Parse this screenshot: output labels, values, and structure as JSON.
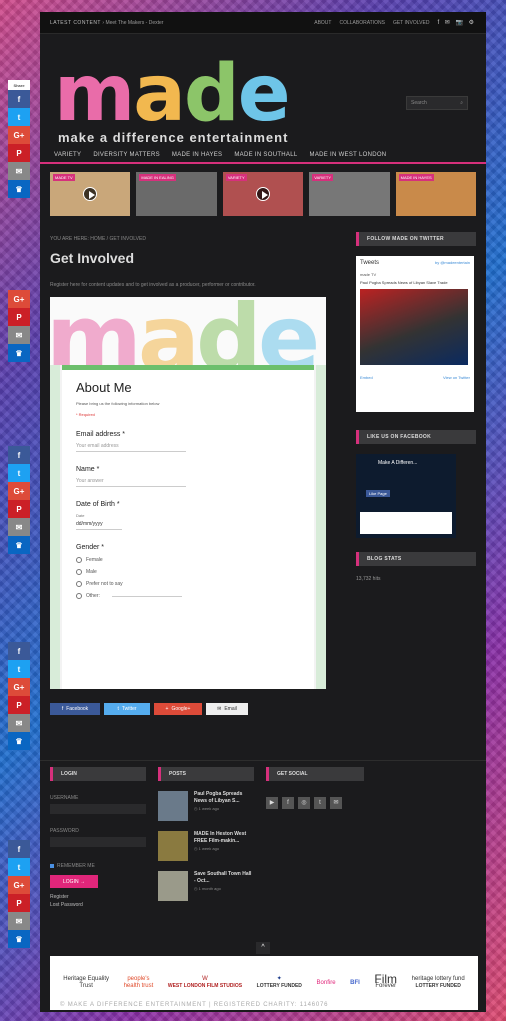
{
  "topbar": {
    "latest_label": "LATEST CONTENT",
    "latest_text": "Meet The Makers - Dexter",
    "links": [
      "ABOUT",
      "COLLABORATIONS",
      "GET INVOLVED"
    ],
    "social": "f ✉ 📷 ⚙"
  },
  "logo": {
    "letters": [
      "m",
      "a",
      "d",
      "e"
    ],
    "tagline": "make a difference entertainment"
  },
  "search": {
    "placeholder": "Search"
  },
  "nav": {
    "items": [
      "VARIETY",
      "DIVERSITY MATTERS",
      "MADE IN HAYES",
      "MADE IN SOUTHALL",
      "MADE IN WEST LONDON"
    ]
  },
  "thumbs": [
    {
      "tag": "MADE TV",
      "play": true,
      "color": "#c9a77a"
    },
    {
      "tag": "MADE IN EALING",
      "play": false,
      "color": "#6a6a6a"
    },
    {
      "tag": "VARIETY",
      "play": true,
      "color": "#b05050"
    },
    {
      "tag": "VARIETY",
      "play": false,
      "color": "#777"
    },
    {
      "tag": "MADE IN HAYES",
      "play": false,
      "color": "#c98a4a"
    }
  ],
  "main": {
    "breadcrumb": "YOU ARE HERE: HOME / GET INVOLVED",
    "title": "Get Involved",
    "intro": "Register here for content updates and to get involved as a producer, performer or contributor.",
    "form": {
      "title": "About Me",
      "desc": "Please bring us the following information below",
      "required": "* Required",
      "email_label": "Email address *",
      "email_placeholder": "Your email address",
      "name_label": "Name *",
      "name_placeholder": "Your answer",
      "dob_label": "Date of Birth *",
      "dob_small": "Date",
      "dob_value": "dd/mm/yyyy",
      "gender_label": "Gender *",
      "gender_options": [
        "Female",
        "Male",
        "Prefer not to say",
        "Other:"
      ]
    },
    "share": [
      {
        "label": "Facebook",
        "icon": "f",
        "color": "#3b5998"
      },
      {
        "label": "Twitter",
        "icon": "t",
        "color": "#55acee"
      },
      {
        "label": "Google+",
        "icon": "+",
        "color": "#dd4b39"
      },
      {
        "label": "Email",
        "icon": "✉",
        "color": "#eeeeee"
      }
    ]
  },
  "sidebar": {
    "twitter_title": "FOLLOW MADE ON TWITTER",
    "tweets_head": "Tweets",
    "tweets_by": "by @madeentertain",
    "tweet_user": "made TV",
    "tweet_text": "Paul Pogba Spreads News of Libyan Slave Trade",
    "tw_embed": "Embed",
    "tw_view": "View on Twitter",
    "facebook_title": "LIKE US ON FACEBOOK",
    "fb_page": "Make A Differen...",
    "fb_like": "Like Page",
    "stats_title": "BLOG STATS",
    "stats_value": "13,732 hits"
  },
  "footer": {
    "login_title": "LOGIN",
    "username_label": "USERNAME",
    "password_label": "PASSWORD",
    "remember_label": "REMEMBER ME",
    "login_button": "LOGIN →",
    "register": "Register",
    "lost_password": "Lost Password",
    "posts_title": "POSTS",
    "posts": [
      {
        "title": "Paul Pogba Spreads News of Libyan S...",
        "date": "1 week ago"
      },
      {
        "title": "MADE In Heston West FREE Film-makin...",
        "date": "1 week ago"
      },
      {
        "title": "Save Southall Town Hall - Oct...",
        "date": "1 month ago"
      }
    ],
    "social_title": "GET SOCIAL",
    "social_icons": [
      "▶",
      "f",
      "◎",
      "t",
      "✉"
    ]
  },
  "sponsors": {
    "items": [
      {
        "top": "Heritage Equality",
        "bottom": "Trust"
      },
      {
        "top": "people's",
        "bottom": "health trust"
      },
      {
        "top": "W",
        "bottom": "WEST LONDON FILM STUDIOS"
      },
      {
        "top": "✦",
        "bottom": "LOTTERY FUNDED"
      },
      {
        "top": "Bonfire",
        "bottom": ""
      },
      {
        "top": "BFI",
        "bottom": ""
      },
      {
        "top": "Film",
        "bottom": "Forever"
      },
      {
        "top": "heritage lottery fund",
        "bottom": "LOTTERY FUNDED"
      }
    ],
    "charity": "© MAKE A DIFFERENCE ENTERTAINMENT | REGISTERED CHARITY: 1146076"
  },
  "share_bar": {
    "label": "Share",
    "buttons": [
      {
        "icon": "f",
        "color": "#3b5998"
      },
      {
        "icon": "t",
        "color": "#1da1f2"
      },
      {
        "icon": "G+",
        "color": "#dd4b39"
      },
      {
        "icon": "P",
        "color": "#cb2027"
      },
      {
        "icon": "✉",
        "color": "#888888"
      },
      {
        "icon": "♛",
        "color": "#0a66c2"
      }
    ]
  }
}
